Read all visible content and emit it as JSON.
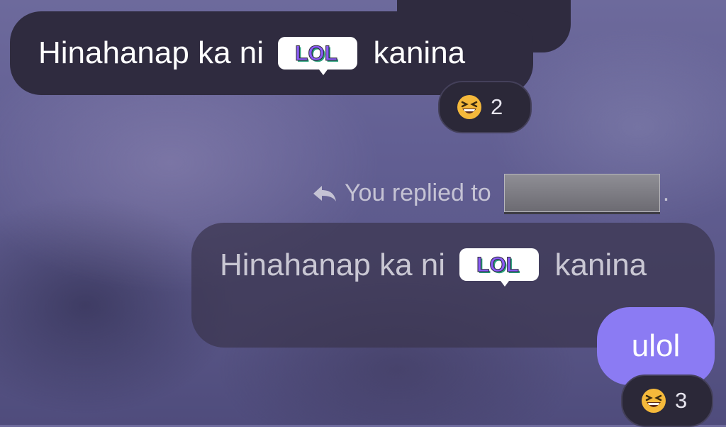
{
  "messages": [
    {
      "id": "msg1",
      "text_before": "Hinahanap ka ni ",
      "sticker": "LOL",
      "text_after": " kanina",
      "reaction": {
        "emoji": "grinning-squinting-face-icon",
        "count": "2"
      }
    },
    {
      "id": "msg2",
      "text_before": "Hinahanap ka ni ",
      "sticker": "LOL",
      "text_after": " kanina"
    },
    {
      "id": "msg3",
      "text": "ulol",
      "reaction": {
        "emoji": "grinning-squinting-face-icon",
        "count": "3"
      }
    }
  ],
  "reply_indicator": {
    "icon": "reply-arrow-icon",
    "text": "You replied to",
    "suffix": "."
  },
  "colors": {
    "incoming_bubble": "#2f2b3f",
    "outgoing_bubble": "#8b7bf3",
    "reaction_bg": "#2b2838",
    "sticker_purple": "#8a5cf5"
  }
}
